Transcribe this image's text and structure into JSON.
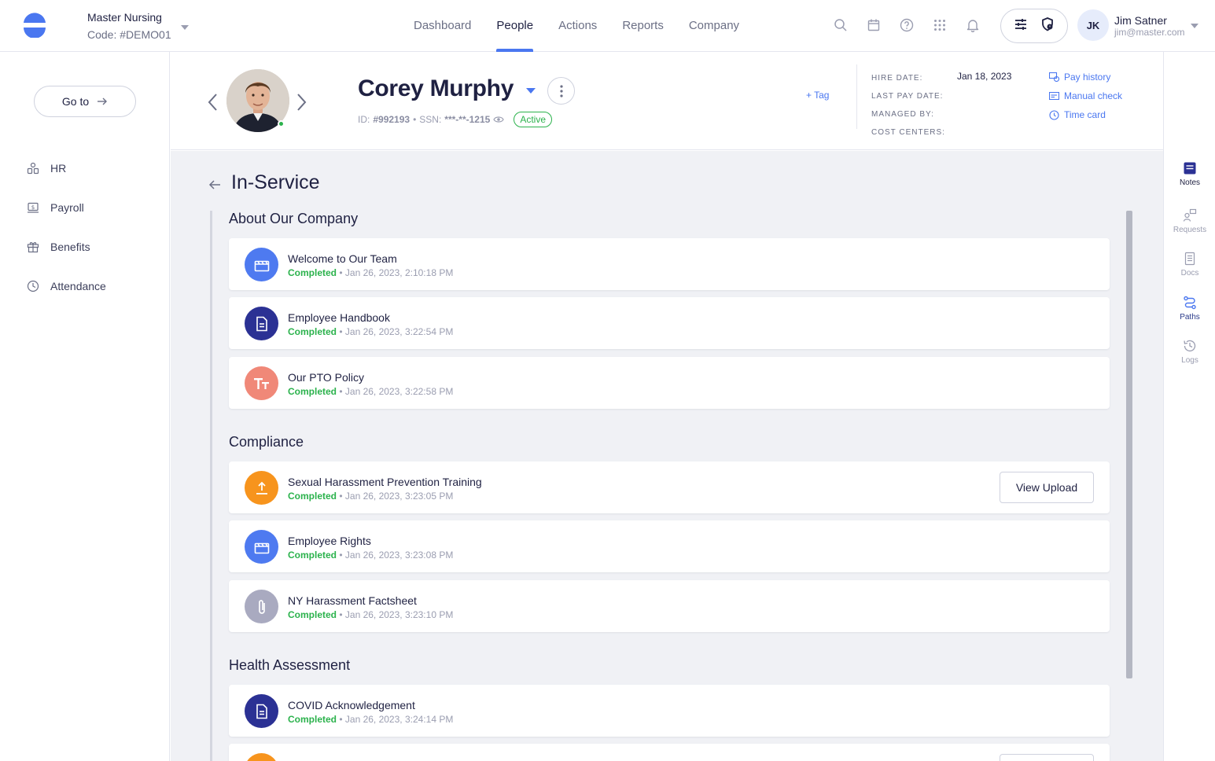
{
  "header": {
    "company_name": "Master Nursing",
    "company_code": "Code: #DEMO01",
    "nav": [
      {
        "label": "Dashboard"
      },
      {
        "label": "People",
        "active": true
      },
      {
        "label": "Actions"
      },
      {
        "label": "Reports"
      },
      {
        "label": "Company"
      }
    ],
    "icons": [
      "search-icon",
      "calendar-icon",
      "help-icon",
      "apps-grid-icon",
      "bell-icon"
    ],
    "user": {
      "initials": "JK",
      "name": "Jim Satner",
      "email": "jim@master.com"
    }
  },
  "sidebar": {
    "goto_label": "Go to",
    "items": [
      {
        "label": "HR",
        "icon": "people-icon"
      },
      {
        "label": "Payroll",
        "icon": "payroll-icon"
      },
      {
        "label": "Benefits",
        "icon": "gift-icon"
      },
      {
        "label": "Attendance",
        "icon": "clock-icon"
      }
    ]
  },
  "rail": {
    "items": [
      {
        "label": "Notes",
        "icon": "notes-icon"
      },
      {
        "label": "Requests",
        "icon": "requests-icon"
      },
      {
        "label": "Docs",
        "icon": "docs-icon"
      },
      {
        "label": "Paths",
        "icon": "paths-icon"
      },
      {
        "label": "Logs",
        "icon": "logs-icon"
      }
    ]
  },
  "profile": {
    "name": "Corey Murphy",
    "id_label": "ID:",
    "id_value": "#992193",
    "ssn_label": "SSN:",
    "ssn_value": "***-**-1215",
    "status": "Active",
    "add_tag": "+ Tag",
    "meta_labels": [
      "HIRE DATE:",
      "LAST PAY DATE:",
      "MANAGED BY:",
      "COST CENTERS:"
    ],
    "hire_date": "Jan 18, 2023",
    "links": [
      "Pay history",
      "Manual check",
      "Time card"
    ]
  },
  "page": {
    "title": "In-Service",
    "status_text": "Completed",
    "sections": [
      {
        "title": "About Our Company",
        "items": [
          {
            "title": "Welcome to Our Team",
            "date": "Jan 26, 2023, 2:10:18 PM",
            "icon": "video-icon"
          },
          {
            "title": "Employee Handbook",
            "date": "Jan 26, 2023, 3:22:54 PM",
            "icon": "document-icon"
          },
          {
            "title": "Our PTO Policy",
            "date": "Jan 26, 2023, 3:22:58 PM",
            "icon": "text-icon"
          }
        ]
      },
      {
        "title": "Compliance",
        "items": [
          {
            "title": "Sexual Harassment Prevention Training",
            "date": "Jan 26, 2023, 3:23:05 PM",
            "icon": "upload-icon",
            "button": "View Upload"
          },
          {
            "title": "Employee Rights",
            "date": "Jan 26, 2023, 3:23:08 PM",
            "icon": "video-icon"
          },
          {
            "title": "NY Harassment Factsheet",
            "date": "Jan 26, 2023, 3:23:10 PM",
            "icon": "paperclip-icon"
          }
        ]
      },
      {
        "title": "Health Assessment",
        "items": [
          {
            "title": "COVID Acknowledgement",
            "date": "Jan 26, 2023, 3:24:14 PM",
            "icon": "document-icon"
          }
        ]
      }
    ]
  },
  "colors": {
    "accent": "#4a77f0",
    "success": "#2bb24c",
    "video": "#4e7af0",
    "document": "#2b3194",
    "text": "#f08878",
    "upload": "#f7941d",
    "paperclip": "#a9aac0"
  }
}
